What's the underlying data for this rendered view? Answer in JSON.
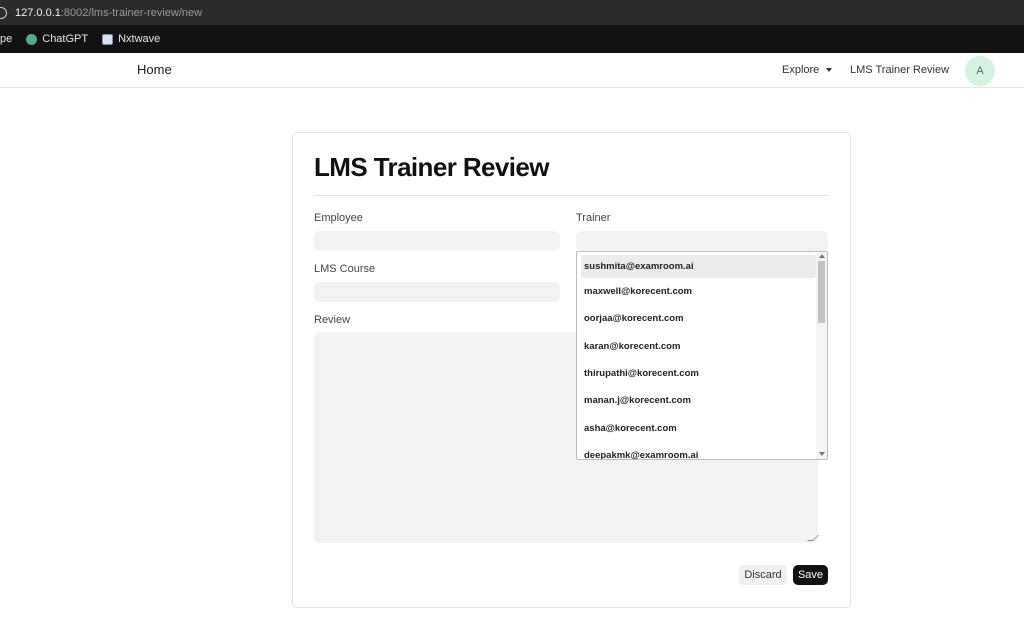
{
  "browser": {
    "url_host": "127.0.0.1",
    "url_path": ":8002/lms-trainer-review/new",
    "bookmarks": [
      {
        "label": "pe",
        "icon": "none"
      },
      {
        "label": "ChatGPT",
        "icon": "chatgpt-icon"
      },
      {
        "label": "Nxtwave",
        "icon": "nxtwave-icon"
      }
    ]
  },
  "header": {
    "home_label": "Home",
    "explore_label": "Explore",
    "lms_link_label": "LMS Trainer Review",
    "avatar_initial": "A"
  },
  "form": {
    "title": "LMS Trainer Review",
    "employee_label": "Employee",
    "employee_value": "",
    "trainer_label": "Trainer",
    "trainer_value": "",
    "course_label": "LMS Course",
    "course_value": "",
    "review_label": "Review",
    "review_value": "",
    "discard_label": "Discard",
    "save_label": "Save"
  },
  "dropdown": {
    "options": [
      "sushmita@examroom.ai",
      "maxwell@korecent.com",
      "oorjaa@korecent.com",
      "karan@korecent.com",
      "thirupathi@korecent.com",
      "manan.j@korecent.com",
      "asha@korecent.com",
      "deepakmk@examroom.ai"
    ],
    "active_index": 0
  },
  "colors": {
    "avatar_bg": "#d6f2e3",
    "save_bg": "#111111",
    "field_bg": "#f3f3f3"
  }
}
